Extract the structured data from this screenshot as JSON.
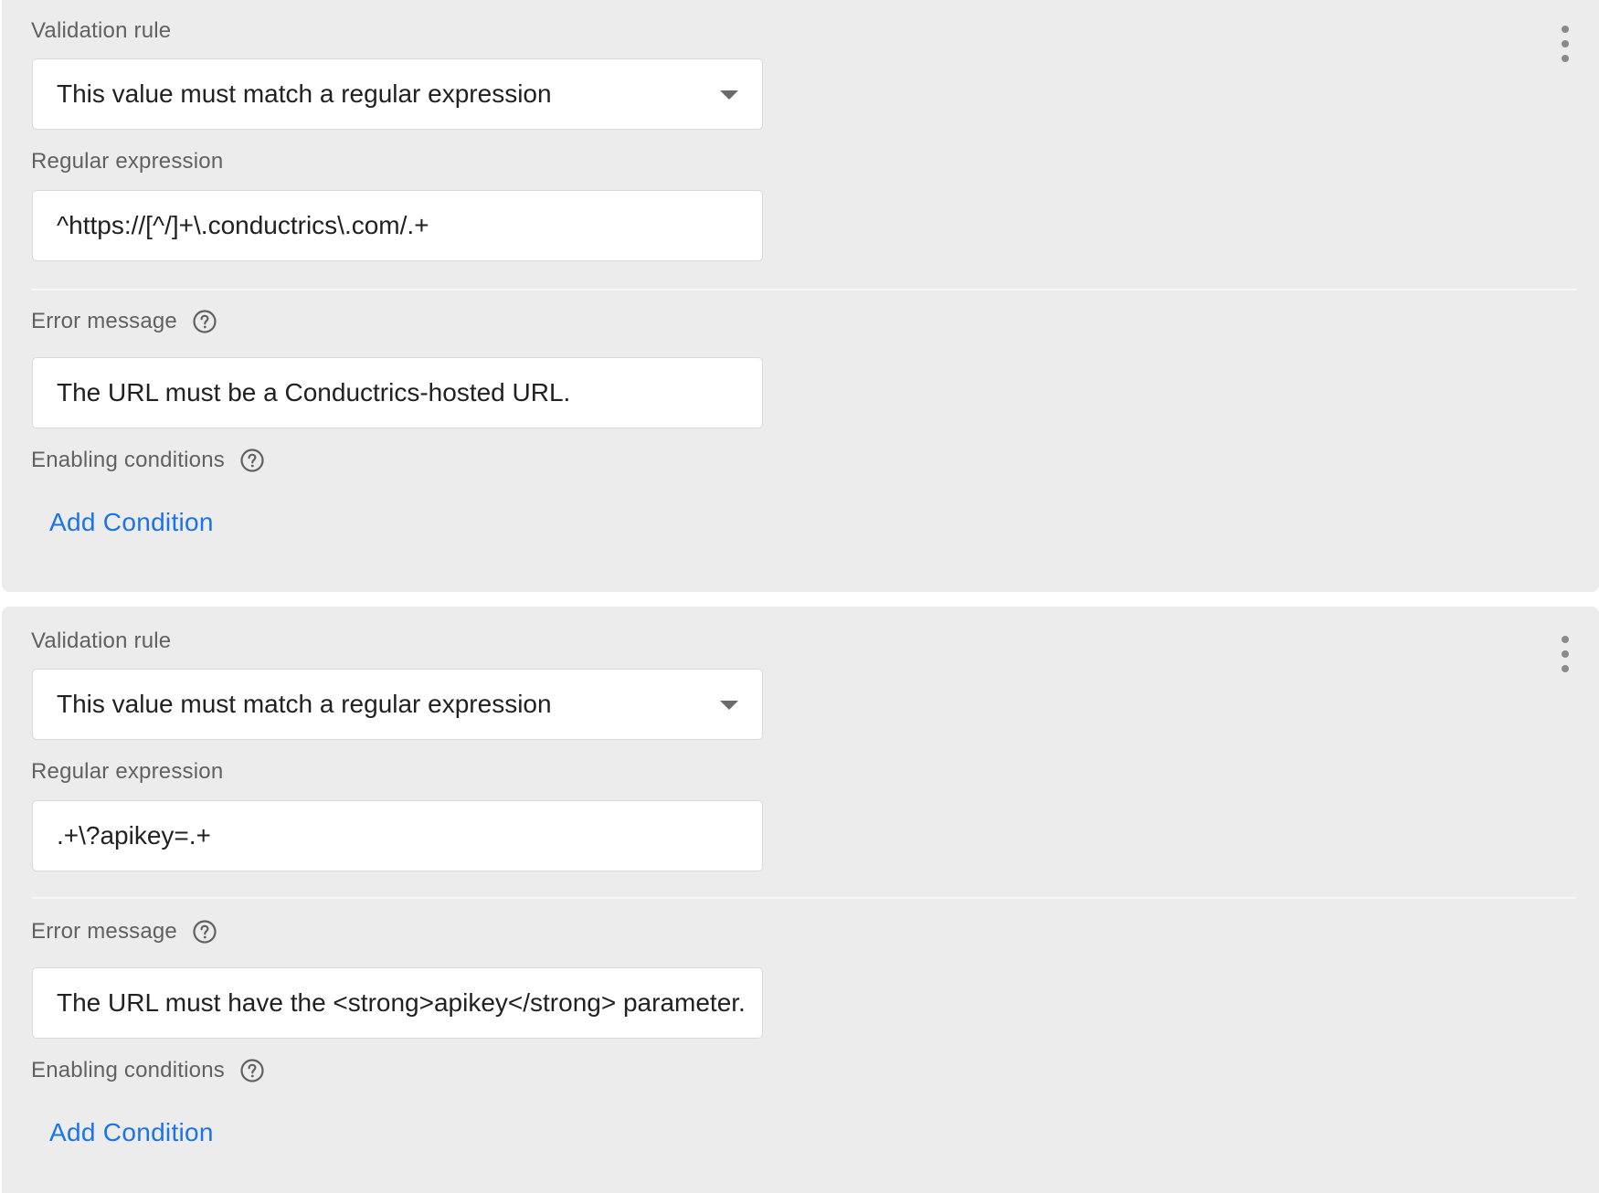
{
  "rules": [
    {
      "validation_rule_label": "Validation rule",
      "validation_rule_value": "This value must match a regular expression",
      "regex_label": "Regular expression",
      "regex_value": "^https://[^/]+\\.conductrics\\.com/.+",
      "error_label": "Error message",
      "error_value": "The URL must be a Conductrics-hosted URL.",
      "conditions_label": "Enabling conditions",
      "add_condition_label": "Add Condition"
    },
    {
      "validation_rule_label": "Validation rule",
      "validation_rule_value": "This value must match a regular expression",
      "regex_label": "Regular expression",
      "regex_value": ".+\\?apikey=.+",
      "error_label": "Error message",
      "error_value": "The URL must have the <strong>apikey</strong> parameter.",
      "conditions_label": "Enabling conditions",
      "add_condition_label": "Add Condition"
    }
  ],
  "icons": {
    "help": "help-circle-icon",
    "menu": "more-vert-icon",
    "dropdown": "arrow-drop-down-icon"
  },
  "colors": {
    "card_background": "#ececec",
    "link": "#1a73e8",
    "label": "#616161",
    "text": "#212121"
  }
}
